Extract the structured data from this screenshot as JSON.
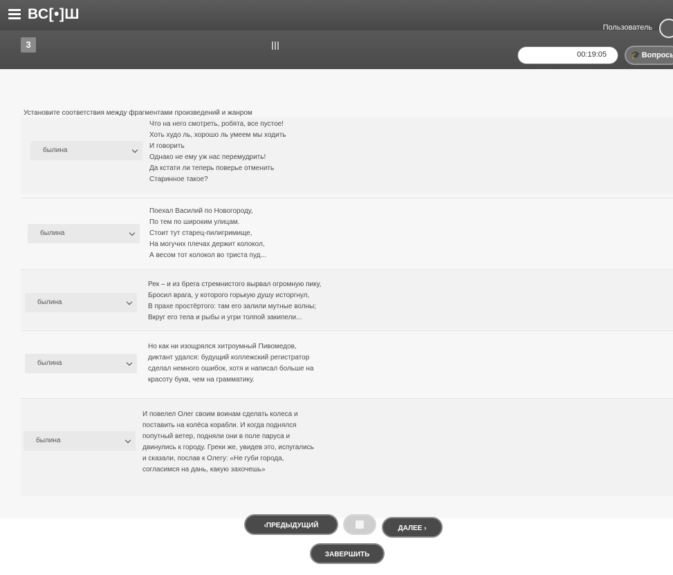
{
  "header": {
    "logo": "ВС[•]Ш",
    "user_label": "Пользователь"
  },
  "toolbar": {
    "question_number": "3",
    "timer": "00:19:05",
    "questions_label": "Вопросы"
  },
  "task": {
    "instruction": "Установите соответствия между фрагментами произведений и жанром",
    "rows": [
      {
        "selected": "былина",
        "lines": [
          "Что на него смотреть, робята, все пустое!",
          "Хоть худо ль, хорошо ль умеем мы ходить",
          "И говорить",
          "Однако не ему уж нас перемудрить!",
          "Да кстати ли теперь поверье отменить",
          "Старинное такое?"
        ]
      },
      {
        "selected": "былина",
        "lines": [
          "Поехал Василий по Новогороду,",
          "По тем по широким улицам.",
          "Стоит тут старец-пилигримище,",
          "На могучих плечах держит колокол,",
          "А весом тот колокол во триста пуд..."
        ]
      },
      {
        "selected": "былина",
        "lines": [
          "Рек – и из брега стремнистого вырвал огромную пику,",
          "Бросил врага, у которого горькую душу исторгнул,",
          "В прахе простёртого: там его залили мутные волны;",
          "Вкруг его тела и рыбы и угри толпой закипели..."
        ]
      },
      {
        "selected": "былина",
        "lines": [
          "Но как ни изощрялся хитроумный Пивомедов,",
          "диктант удался: будущий коллежский регистратор",
          "сделал немного ошибок, хотя и написал больше на",
          "красоту букв, чем на грамматику."
        ]
      },
      {
        "selected": "былина",
        "lines": [
          "И повелел Олег своим воинам сделать колеса и",
          "поставить на колёса корабли. И когда поднялся",
          "попутный ветер, подняли они в поле паруса и",
          "двинулись к городу. Греки же, увидев это, испугались",
          "и сказали, послав к Олегу: «Не губи города,",
          "согласимся на дань, какую захочешь»"
        ]
      }
    ]
  },
  "nav": {
    "prev_label": "‹ПРЕДЫДУЩИЙ",
    "next_label": "ДАЛЕЕ ›",
    "finish_label": "ЗАВЕРШИТЬ"
  }
}
